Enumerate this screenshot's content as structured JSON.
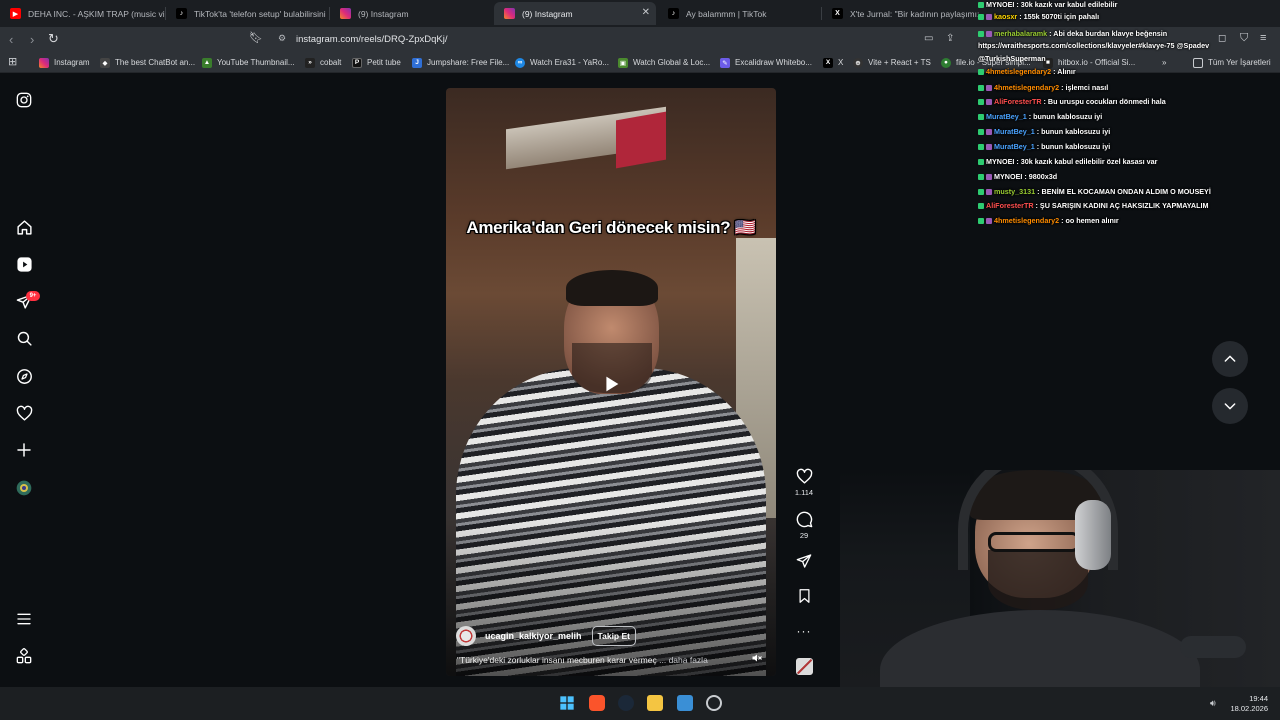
{
  "tabs": [
    {
      "title": "DEHA INC. - AŞKIM TRAP (music vide",
      "icon": "youtube-icon",
      "active": false
    },
    {
      "title": "TikTok'ta 'telefon setup' bulabilirsini",
      "icon": "tiktok-icon",
      "active": false
    },
    {
      "title": "(9) Instagram",
      "icon": "instagram-icon",
      "active": false
    },
    {
      "title": "(9) Instagram",
      "icon": "instagram-icon",
      "active": true
    },
    {
      "title": "Ay balammm | TikTok",
      "icon": "tiktok-icon",
      "active": false
    },
    {
      "title": "X'te Jurnal: \"Bir kadının paylaşımı: \"E",
      "icon": "x-icon",
      "active": false
    }
  ],
  "address": {
    "url": "instagram.com/reels/DRQ-ZpxDqKj/"
  },
  "bookmarks": [
    {
      "label": "Instagram",
      "icon": "instagram-icon"
    },
    {
      "label": "The best ChatBot an...",
      "icon": "chatbot-icon"
    },
    {
      "label": "YouTube Thumbnail...",
      "icon": "thumbnail-icon"
    },
    {
      "label": "cobalt",
      "icon": "cobalt-icon"
    },
    {
      "label": "Petit tube",
      "icon": "petit-tube-icon"
    },
    {
      "label": "Jumpshare: Free File...",
      "icon": "jumpshare-icon"
    },
    {
      "label": "Watch Era31 - YaRo...",
      "icon": "era31-icon"
    },
    {
      "label": "Watch Global & Loc...",
      "icon": "watch-global-icon"
    },
    {
      "label": "Excalidraw Whitebo...",
      "icon": "excalidraw-icon"
    },
    {
      "label": "X",
      "icon": "x-icon"
    },
    {
      "label": "Vite + React + TS",
      "icon": "vite-icon"
    },
    {
      "label": "file.io - Super simpl...",
      "icon": "fileio-icon"
    },
    {
      "label": "hitbox.io - Official Si...",
      "icon": "hitbox-icon"
    }
  ],
  "bookmarks_more": "»",
  "bookmarks_all": "Tüm Yer İşaretleri",
  "sidebar": {
    "notification_badge": "9+"
  },
  "reel": {
    "overlay_text": "Amerika'dan Geri dönecek misin? 🇺🇸",
    "author": "ucagin_kalkiyor_melih",
    "follow_label": "Takip Et",
    "description": "\"Türkiye'deki zorluklar insanı mecburen karar vermeç",
    "description_more": "... daha fazla",
    "likes": "1.114",
    "comments": "29"
  },
  "chat": [
    {
      "user": "MYNOEI",
      "msg": ": 30k kazık var kabul edilebilir",
      "color": "#ffffff"
    },
    {
      "user": "kaosxr",
      "msg": ": 155k 5070ti için pahalı",
      "color": "#ffd700"
    },
    {
      "user": "merhabalaramk",
      "msg": ": Abi deka burdan klavye beğensin",
      "color": "#9acd32"
    },
    {
      "user": "4hmetislegendary2",
      "msg": ": Alınır",
      "color": "#ff8c00"
    },
    {
      "user": "4hmetislegendary2",
      "msg": ": işlemci nasıl",
      "color": "#ff8c00"
    },
    {
      "user": "AliForesterTR",
      "msg": ": Bu uruspu cocukları dönmedi hala",
      "color": "#ff4f4f"
    },
    {
      "user": "MuratBey_1",
      "msg": ": bunun kablosuzu iyi",
      "color": "#4aa3ff"
    },
    {
      "user": "MuratBey_1",
      "msg": ": bunun kablosuzu iyi",
      "color": "#4aa3ff"
    },
    {
      "user": "MuratBey_1",
      "msg": ": bunun kablosuzu iyi",
      "color": "#4aa3ff"
    },
    {
      "user": "MYNOEI",
      "msg": ": 30k kazık kabul edilebilir özel kasası var",
      "color": "#ffffff"
    },
    {
      "user": "MYNOEI",
      "msg": ": 9800x3d",
      "color": "#ffffff"
    },
    {
      "user": "musty_3131",
      "msg": ": BENİM EL KOCAMAN ONDAN ALDIM O MOUSEYİ",
      "color": "#9acd32"
    },
    {
      "user": "AliForesterTR",
      "msg": ": ŞU SARIŞIN KADINI AÇ HAKSIZLIK YAPMAYALIM",
      "color": "#ff4f4f"
    },
    {
      "user": "4hmetislegendary2",
      "msg": ": oo hemen alınır",
      "color": "#ff8c00"
    }
  ],
  "chat_link": "https://wraithesports.com/collections/klavyeler#klavye-75 @Spadev",
  "chat_link2": "@TurkishSuperman",
  "clock": {
    "time": "19:44",
    "date": "18.02.2026"
  }
}
